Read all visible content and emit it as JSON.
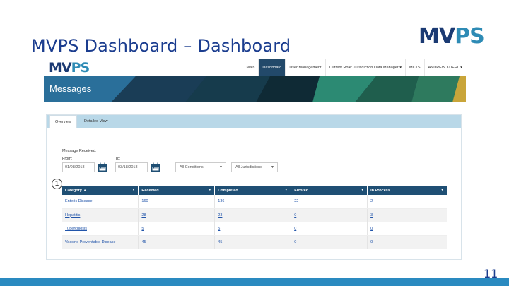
{
  "slide": {
    "title": "MVPS Dashboard – Dashboard",
    "logo_mv": "MV",
    "logo_ps": "PS",
    "page_number": "11",
    "callout": "1"
  },
  "app": {
    "logo_mv": "MV",
    "logo_ps": "PS",
    "nav": [
      {
        "label": "Main"
      },
      {
        "label": "Dashboard"
      },
      {
        "label": "User Management"
      },
      {
        "label": "Current Role: Jurisdiction Data Manager ▾"
      },
      {
        "label": "MCTS"
      },
      {
        "label": "ANDREW KUEHL ▾"
      }
    ],
    "hero_title": "Messages",
    "tabs": [
      {
        "label": "Overview"
      },
      {
        "label": "Detailed View"
      }
    ],
    "filters": {
      "heading": "Message Received:",
      "from_label": "From:",
      "to_label": "To:",
      "from_value": "01/08/2018",
      "to_value": "03/18/2018",
      "conditions": "All Conditions",
      "jurisdictions": "All Jurisdictions"
    },
    "table": {
      "headers": [
        "Category ▲",
        "Received",
        "Completed",
        "Errored",
        "In Process"
      ],
      "rows": [
        [
          "Enteric Disease",
          "160",
          "136",
          "22",
          "2"
        ],
        [
          "Hepatitis",
          "28",
          "23",
          "0",
          "3"
        ],
        [
          "Tuberculosis",
          "5",
          "5",
          "0",
          "0"
        ],
        [
          "Vaccine Preventable Disease",
          "45",
          "45",
          "0",
          "0"
        ]
      ]
    }
  },
  "colors": {
    "title": "#1b3d8f",
    "navy": "#1b3a73",
    "accent": "#2e8bb5",
    "header": "#1f4f74"
  }
}
